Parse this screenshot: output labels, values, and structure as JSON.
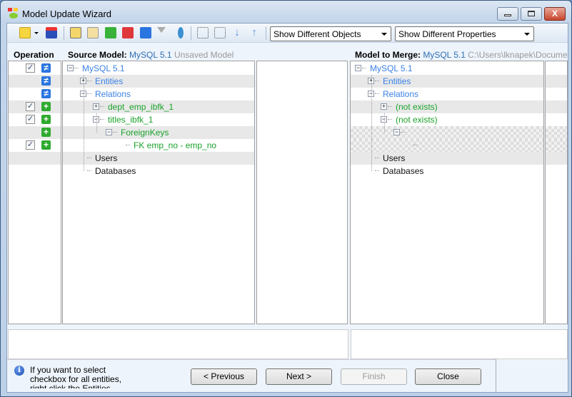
{
  "window": {
    "title": "Model Update Wizard",
    "close_glyph": "X"
  },
  "toolbar": {
    "icons": [
      "open-import-icon",
      "save-icon",
      "select-all-icon",
      "deselect-all-icon",
      "check-added-icon",
      "check-removed-icon",
      "check-changed-icon",
      "filter-icon",
      "synchronize-icon",
      "collapse-all-icon",
      "expand-all-icon",
      "move-down-icon",
      "move-up-icon"
    ],
    "objects_filter": "Show Different Objects",
    "properties_filter": "Show Different Properties"
  },
  "headers": {
    "operation": "Operation",
    "source_label": "Source Model:",
    "source_name": "MySQL 5.1",
    "source_status": "Unsaved Model",
    "merge_label": "Model to Merge:",
    "merge_name": "MySQL 5.1",
    "merge_path": "C:\\Users\\lknapek\\Documents"
  },
  "operations": [
    {
      "checked": true,
      "op": "≠"
    },
    {
      "checked": false,
      "op": "≠"
    },
    {
      "checked": false,
      "op": "≠"
    },
    {
      "checked": true,
      "op": "+"
    },
    {
      "checked": true,
      "op": "+"
    },
    {
      "checked": false,
      "op": "+"
    },
    {
      "checked": true,
      "op": "+"
    },
    {
      "checked": false,
      "op": ""
    },
    {
      "checked": false,
      "op": ""
    }
  ],
  "check_glyph": "✓",
  "source_tree": [
    "MySQL 5.1",
    "Entities",
    "Relations",
    "dept_emp_ibfk_1",
    "titles_ibfk_1",
    "ForeignKeys",
    "FK emp_no - emp_no",
    "Users",
    "Databases"
  ],
  "merge_tree": [
    "MySQL 5.1",
    "Entities",
    "Relations",
    "(not exists)",
    "(not exists)",
    "",
    "",
    "Users",
    "Databases"
  ],
  "info": {
    "text": "If you want to select checkbox for all entities, right click the Entities"
  },
  "buttons": {
    "previous": "< Previous",
    "next": "Next >",
    "finish": "Finish",
    "close": "Close"
  }
}
